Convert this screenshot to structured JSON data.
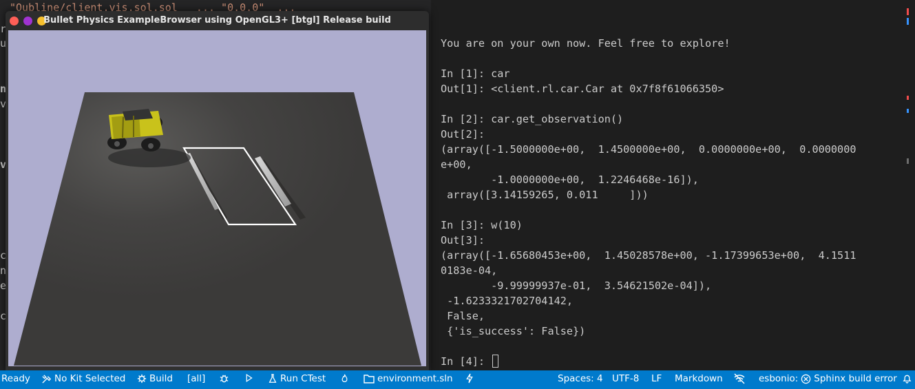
{
  "background_editor": {
    "top_line": "\"Oubline/client.vis.sol.sol   ... \"0.0.0\"  ... ",
    "peek_letters": [
      "r",
      "u",
      "n",
      "v",
      "v",
      "c",
      "n",
      "e",
      "c"
    ]
  },
  "window": {
    "title": "Bullet Physics ExampleBrowser using OpenGL3+ [btgl] Release build",
    "colors": {
      "close": "#ff5f57",
      "minimize": "#a033d1",
      "maximize": "#f7c02d"
    }
  },
  "terminal": {
    "lines": [
      "You are on your own now. Feel free to explore!",
      "",
      "In [1]: car",
      "Out[1]: <client.rl.car.Car at 0x7f8f61066350>",
      "",
      "In [2]: car.get_observation()",
      "Out[2]:",
      "(array([-1.5000000e+00,  1.4500000e+00,  0.0000000e+00,  0.0000000",
      "e+00,",
      "        -1.0000000e+00,  1.2246468e-16]),",
      " array([3.14159265, 0.011     ]))",
      "",
      "In [3]: w(10)",
      "Out[3]:",
      "(array([-1.65680453e+00,  1.45028578e+00, -1.17399653e+00,  4.1511",
      "0183e-04,",
      "        -9.99999937e-01,  3.54621502e-04]),",
      " -1.6233321702704142,",
      " False,",
      " {'is_success': False})",
      ""
    ],
    "prompt": "In [4]: "
  },
  "statusbar": {
    "ready": "Ready",
    "kit": "No Kit Selected",
    "build": "Build",
    "target": "[all]",
    "ctest": "Run CTest",
    "solution": "environment.sln",
    "spaces": "Spaces: 4",
    "encoding": "UTF-8",
    "eol": "LF",
    "language": "Markdown",
    "esbonio": "esbonio:",
    "sphinx": "Sphinx build error",
    "colors": {
      "bar": "#007acc"
    }
  }
}
